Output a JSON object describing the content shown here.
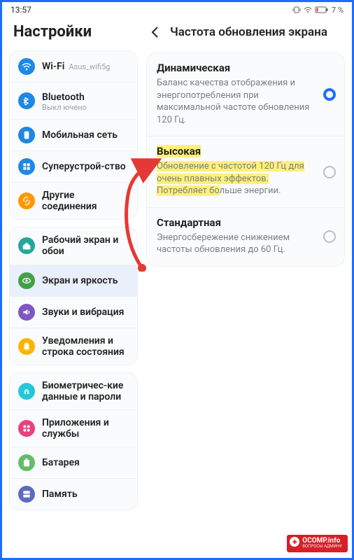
{
  "status": {
    "time": "13:57",
    "battery": "7 %"
  },
  "left_title": "Настройки",
  "detail_title": "Частота обновления экрана",
  "groups": [
    [
      {
        "id": "wifi",
        "label": "Wi-Fi",
        "sub": "Asus_wifi5g",
        "icon": "wifi",
        "color": "#1e88e5"
      },
      {
        "id": "bluetooth",
        "label": "Bluetooth",
        "sub": "Выкл\nючено",
        "stack": true,
        "icon": "bt",
        "color": "#1e88e5"
      },
      {
        "id": "mobile",
        "label": "Мобильная сеть",
        "icon": "sim",
        "color": "#1e88e5"
      },
      {
        "id": "super",
        "label": "Суперустрой-ство",
        "icon": "grid",
        "color": "#1e88e5"
      },
      {
        "id": "more",
        "label": "Другие соединения",
        "icon": "link",
        "color": "#ff9800"
      }
    ],
    [
      {
        "id": "home",
        "label": "Рабочий экран и обои",
        "icon": "home",
        "color": "#26a69a"
      },
      {
        "id": "display",
        "label": "Экран и яркость",
        "icon": "eye",
        "color": "#43a047",
        "active": true
      },
      {
        "id": "sound",
        "label": "Звуки и вибрация",
        "icon": "sound",
        "color": "#7e57c2"
      },
      {
        "id": "notif",
        "label": "Уведомления и строка состояния",
        "icon": "bell",
        "color": "#ffb300"
      }
    ],
    [
      {
        "id": "bio",
        "label": "Биометричес-кие данные и пароли",
        "icon": "finger",
        "color": "#26c6da"
      },
      {
        "id": "apps",
        "label": "Приложения и службы",
        "icon": "apps",
        "color": "#ec407a"
      },
      {
        "id": "battery",
        "label": "Батарея",
        "icon": "batt",
        "color": "#66bb6a"
      },
      {
        "id": "storage",
        "label": "Память",
        "icon": "storage",
        "color": "#5c6bc0"
      }
    ]
  ],
  "options": [
    {
      "id": "dynamic",
      "title": "Динамическая",
      "desc": "Баланс качества отображения и энергопотребления при максимальной частоте обновления 120 Гц.",
      "selected": true
    },
    {
      "id": "high",
      "title": "Высокая",
      "desc": "Обновление с частотой 120 Гц для очень плавных эффектов. Потребляет больше энергии.",
      "highlight": true
    },
    {
      "id": "standard",
      "title": "Стандартная",
      "desc": "Энергосбережение снижением частоты обновления до 60 Гц."
    }
  ],
  "watermark": {
    "line1": "OCOMP.info",
    "line2": "ВОПРОСЫ АДМИНУ"
  }
}
